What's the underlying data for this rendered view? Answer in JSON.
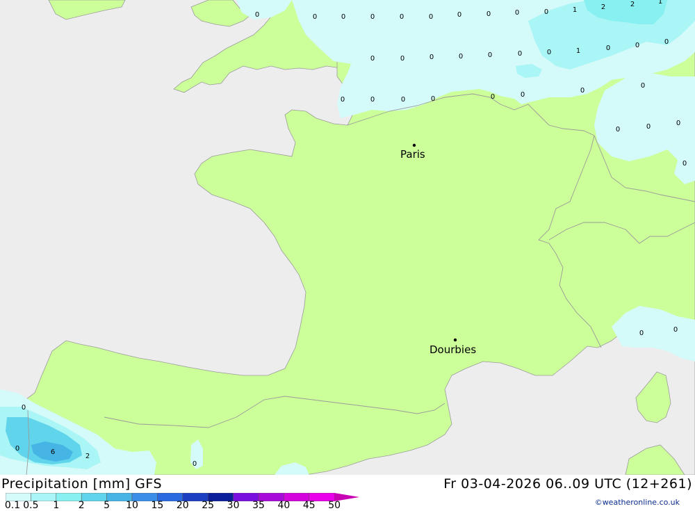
{
  "title": "Precipitation [mm] GFS",
  "datetime": "Fr 03-04-2026 06..09 UTC (12+261)",
  "credit": "©weatheronline.co.uk",
  "colors": {
    "land": "#ccff99",
    "sea": "#ededed",
    "p01": "#d4fafa",
    "p05": "#aaf5f5",
    "p1": "#88f0f0",
    "p2": "#60d4ea",
    "p5": "#46b5e6",
    "p10": "#3a8ee8",
    "border": "#9a9a9a"
  },
  "legend": {
    "labels": [
      "0.1",
      "0.5",
      "1",
      "2",
      "5",
      "10",
      "15",
      "20",
      "25",
      "30",
      "35",
      "40",
      "45",
      "50"
    ],
    "colors": [
      "#d4fafa",
      "#aaf5f5",
      "#88f0f0",
      "#60d4ea",
      "#46b5e6",
      "#3a8ee8",
      "#2a6ae0",
      "#1b3fc0",
      "#0b1f9a",
      "#7a10e0",
      "#a80ad8",
      "#d206dc",
      "#ea00ea",
      "#c800b4"
    ]
  },
  "cities": [
    {
      "name": "Paris"
    },
    {
      "name": "Dourbies"
    }
  ],
  "values": [
    "0",
    "0",
    "0",
    "0",
    "0",
    "0",
    "0",
    "0",
    "0",
    "1",
    "2",
    "2",
    "1",
    "0",
    "0",
    "0",
    "0",
    "0",
    "0",
    "0",
    "1",
    "0",
    "0",
    "0",
    "0",
    "0",
    "0",
    "0",
    "0",
    "0",
    "0",
    "0",
    "0",
    "0",
    "0",
    "0",
    "0",
    "0",
    "0",
    "0",
    "0",
    "6",
    "2",
    "0"
  ]
}
